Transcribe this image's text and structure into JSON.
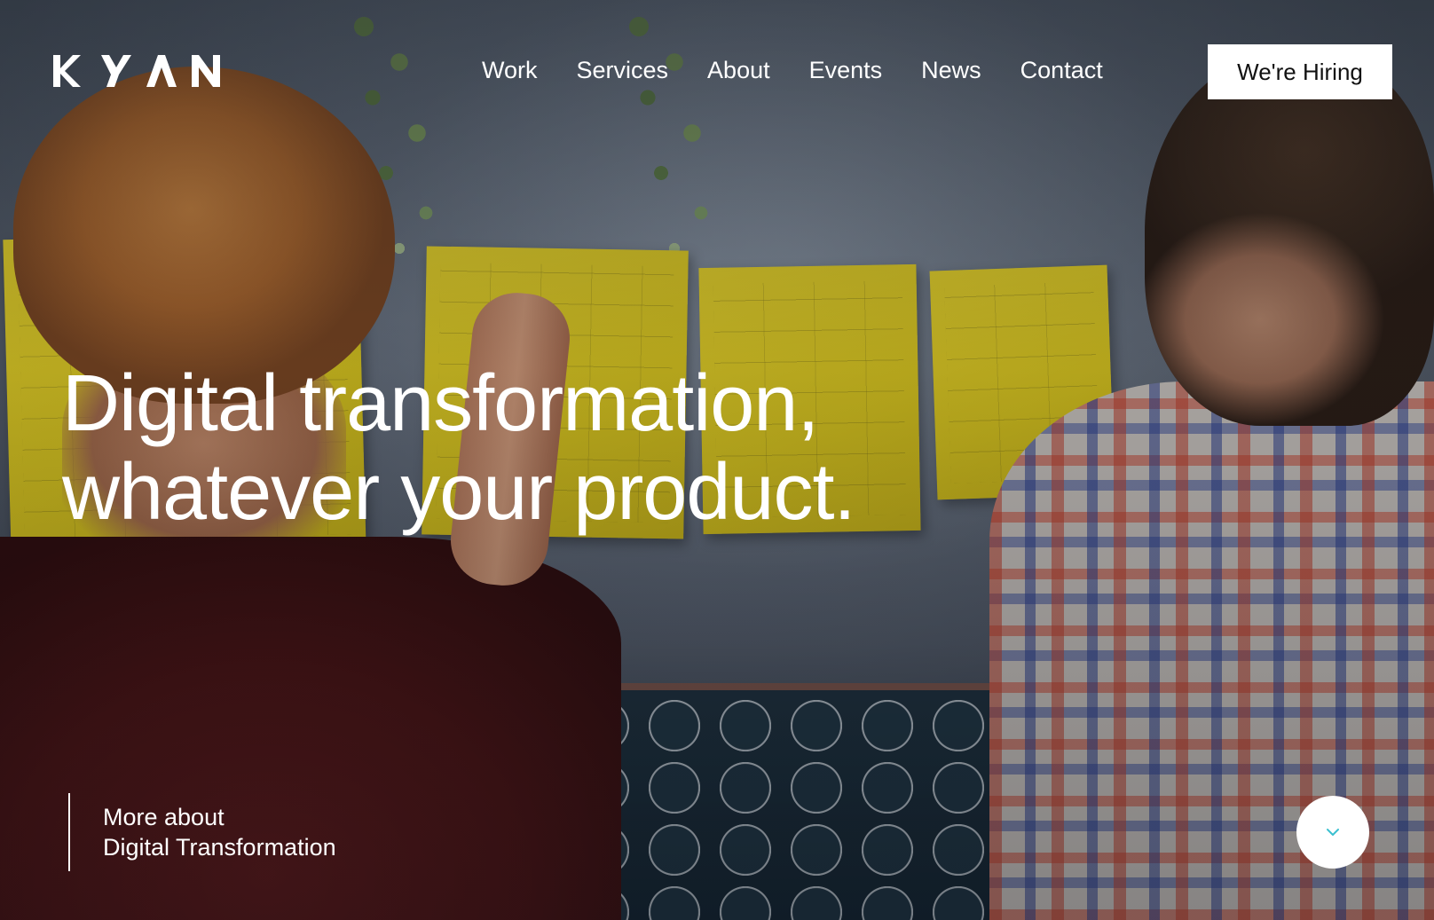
{
  "brand": {
    "logo_text": "KYAN",
    "accent_color": "#3cc0d0"
  },
  "nav": {
    "items": [
      {
        "label": "Work"
      },
      {
        "label": "Services"
      },
      {
        "label": "About"
      },
      {
        "label": "Events"
      },
      {
        "label": "News"
      },
      {
        "label": "Contact"
      }
    ],
    "cta_label": "We're Hiring"
  },
  "hero": {
    "headline_line1": "Digital transformation,",
    "headline_line2": "whatever your product.",
    "more_about_label": "More about",
    "more_about_topic": "Digital Transformation",
    "scroll_icon": "chevron-down-icon"
  }
}
